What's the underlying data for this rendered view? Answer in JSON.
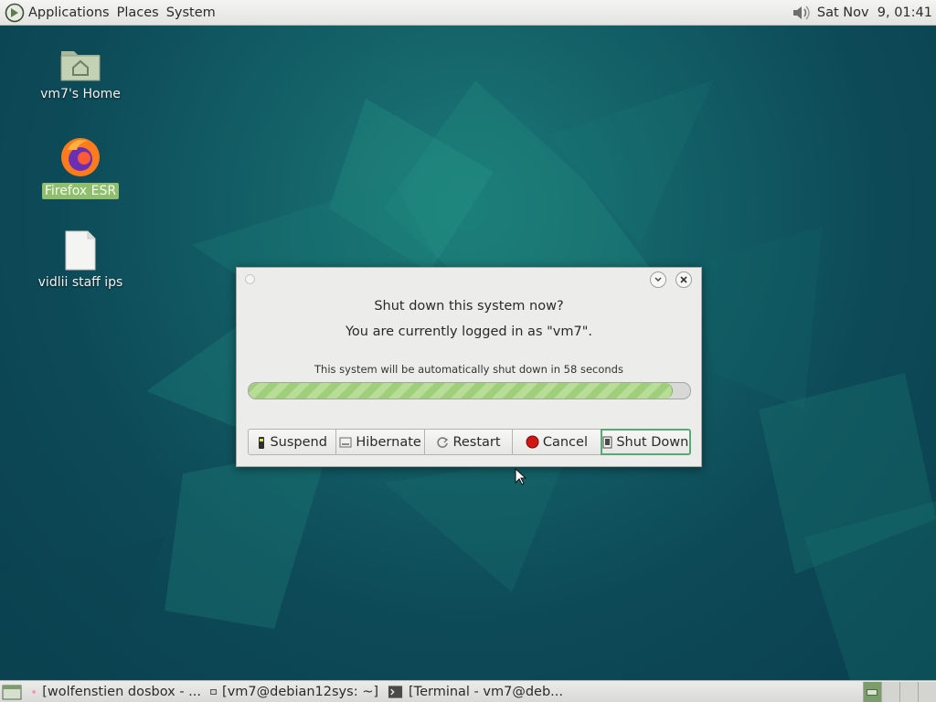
{
  "top_panel": {
    "menus": [
      "Applications",
      "Places",
      "System"
    ],
    "clock": "Sat Nov  9, 01:41"
  },
  "desktop": {
    "icons": [
      {
        "label": "vm7's Home",
        "icon": "home-folder-icon"
      },
      {
        "label": "Firefox ESR",
        "icon": "firefox-icon"
      },
      {
        "label": "vidlii staff ips",
        "icon": "document-icon"
      }
    ]
  },
  "dialog": {
    "heading": "Shut down this system now?",
    "subheading": "You are currently logged in as \"vm7\".",
    "progress_label": "This system will be automatically shut down in 58 seconds",
    "progress_fraction": 0.96,
    "buttons": {
      "suspend": "Suspend",
      "hibernate": "Hibernate",
      "restart": "Restart",
      "cancel": "Cancel",
      "shutdown": "Shut Down"
    }
  },
  "taskbar": {
    "tasks": [
      "[wolfenstien dosbox - ...",
      "[vm7@debian12sys: ~]",
      "[Terminal - vm7@deb..."
    ]
  },
  "colors": {
    "accent": "#5aa878",
    "progress": "#a8d585",
    "selection": "#8fbe6e",
    "desktop": "#0f4f5b"
  }
}
